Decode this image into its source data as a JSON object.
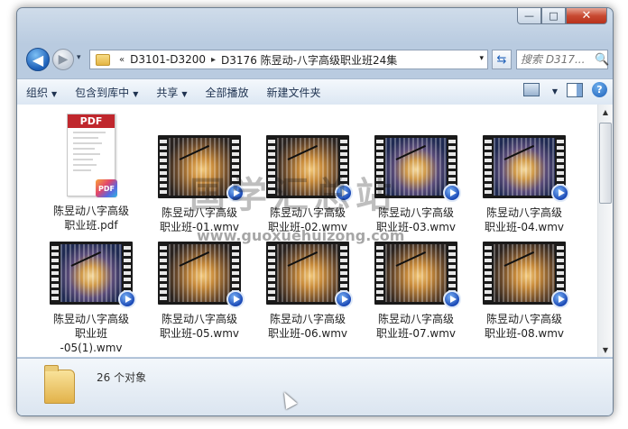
{
  "window": {
    "caption": {
      "minimize_glyph": "—",
      "maximize_glyph": "□",
      "close_glyph": "✕"
    }
  },
  "nav": {
    "back_glyph": "◀",
    "forward_glyph": "▶",
    "history_glyph": "▾",
    "breadcrumb": {
      "overflow": "«",
      "segments": [
        "D3101-D3200",
        "D3176 陈昱动-八字高级职业班24集"
      ],
      "separator": "▸"
    },
    "address_dropdown_glyph": "▾",
    "refresh_glyph": "⇆",
    "search_placeholder": "搜索 D317...",
    "search_icon_glyph": "🔍"
  },
  "toolbar": {
    "organize": "组织",
    "include_in_library": "包含到库中",
    "share": "共享",
    "play_all": "全部播放",
    "new_folder": "新建文件夹",
    "dropdown_glyph": "▼",
    "help_glyph": "?"
  },
  "files": [
    {
      "name": "陈昱动八字高级\n职业班.pdf",
      "kind": "pdf",
      "pdf_label": "PDF",
      "badge_label": "PDF"
    },
    {
      "name": "陈昱动八字高级\n职业班-01.wmv",
      "kind": "video",
      "tone": "warm"
    },
    {
      "name": "陈昱动八字高级\n职业班-02.wmv",
      "kind": "video",
      "tone": "warm"
    },
    {
      "name": "陈昱动八字高级\n职业班-03.wmv",
      "kind": "video",
      "tone": "cool"
    },
    {
      "name": "陈昱动八字高级\n职业班-04.wmv",
      "kind": "video",
      "tone": "cool"
    },
    {
      "name": "陈昱动八字高级\n职业班\n-05(1).wmv",
      "kind": "video",
      "tone": "cool"
    },
    {
      "name": "陈昱动八字高级\n职业班-05.wmv",
      "kind": "video",
      "tone": "warm"
    },
    {
      "name": "陈昱动八字高级\n职业班-06.wmv",
      "kind": "video",
      "tone": "warm"
    },
    {
      "name": "陈昱动八字高级\n职业班-07.wmv",
      "kind": "video",
      "tone": "warm"
    },
    {
      "name": "陈昱动八字高级\n职业班-08.wmv",
      "kind": "video",
      "tone": "warm"
    }
  ],
  "scrollbar": {
    "up_glyph": "▲",
    "down_glyph": "▼"
  },
  "details": {
    "item_count": "26 个对象"
  },
  "watermark": {
    "text": "国学汇总站",
    "url": "www.guoxuehuizong.com"
  }
}
